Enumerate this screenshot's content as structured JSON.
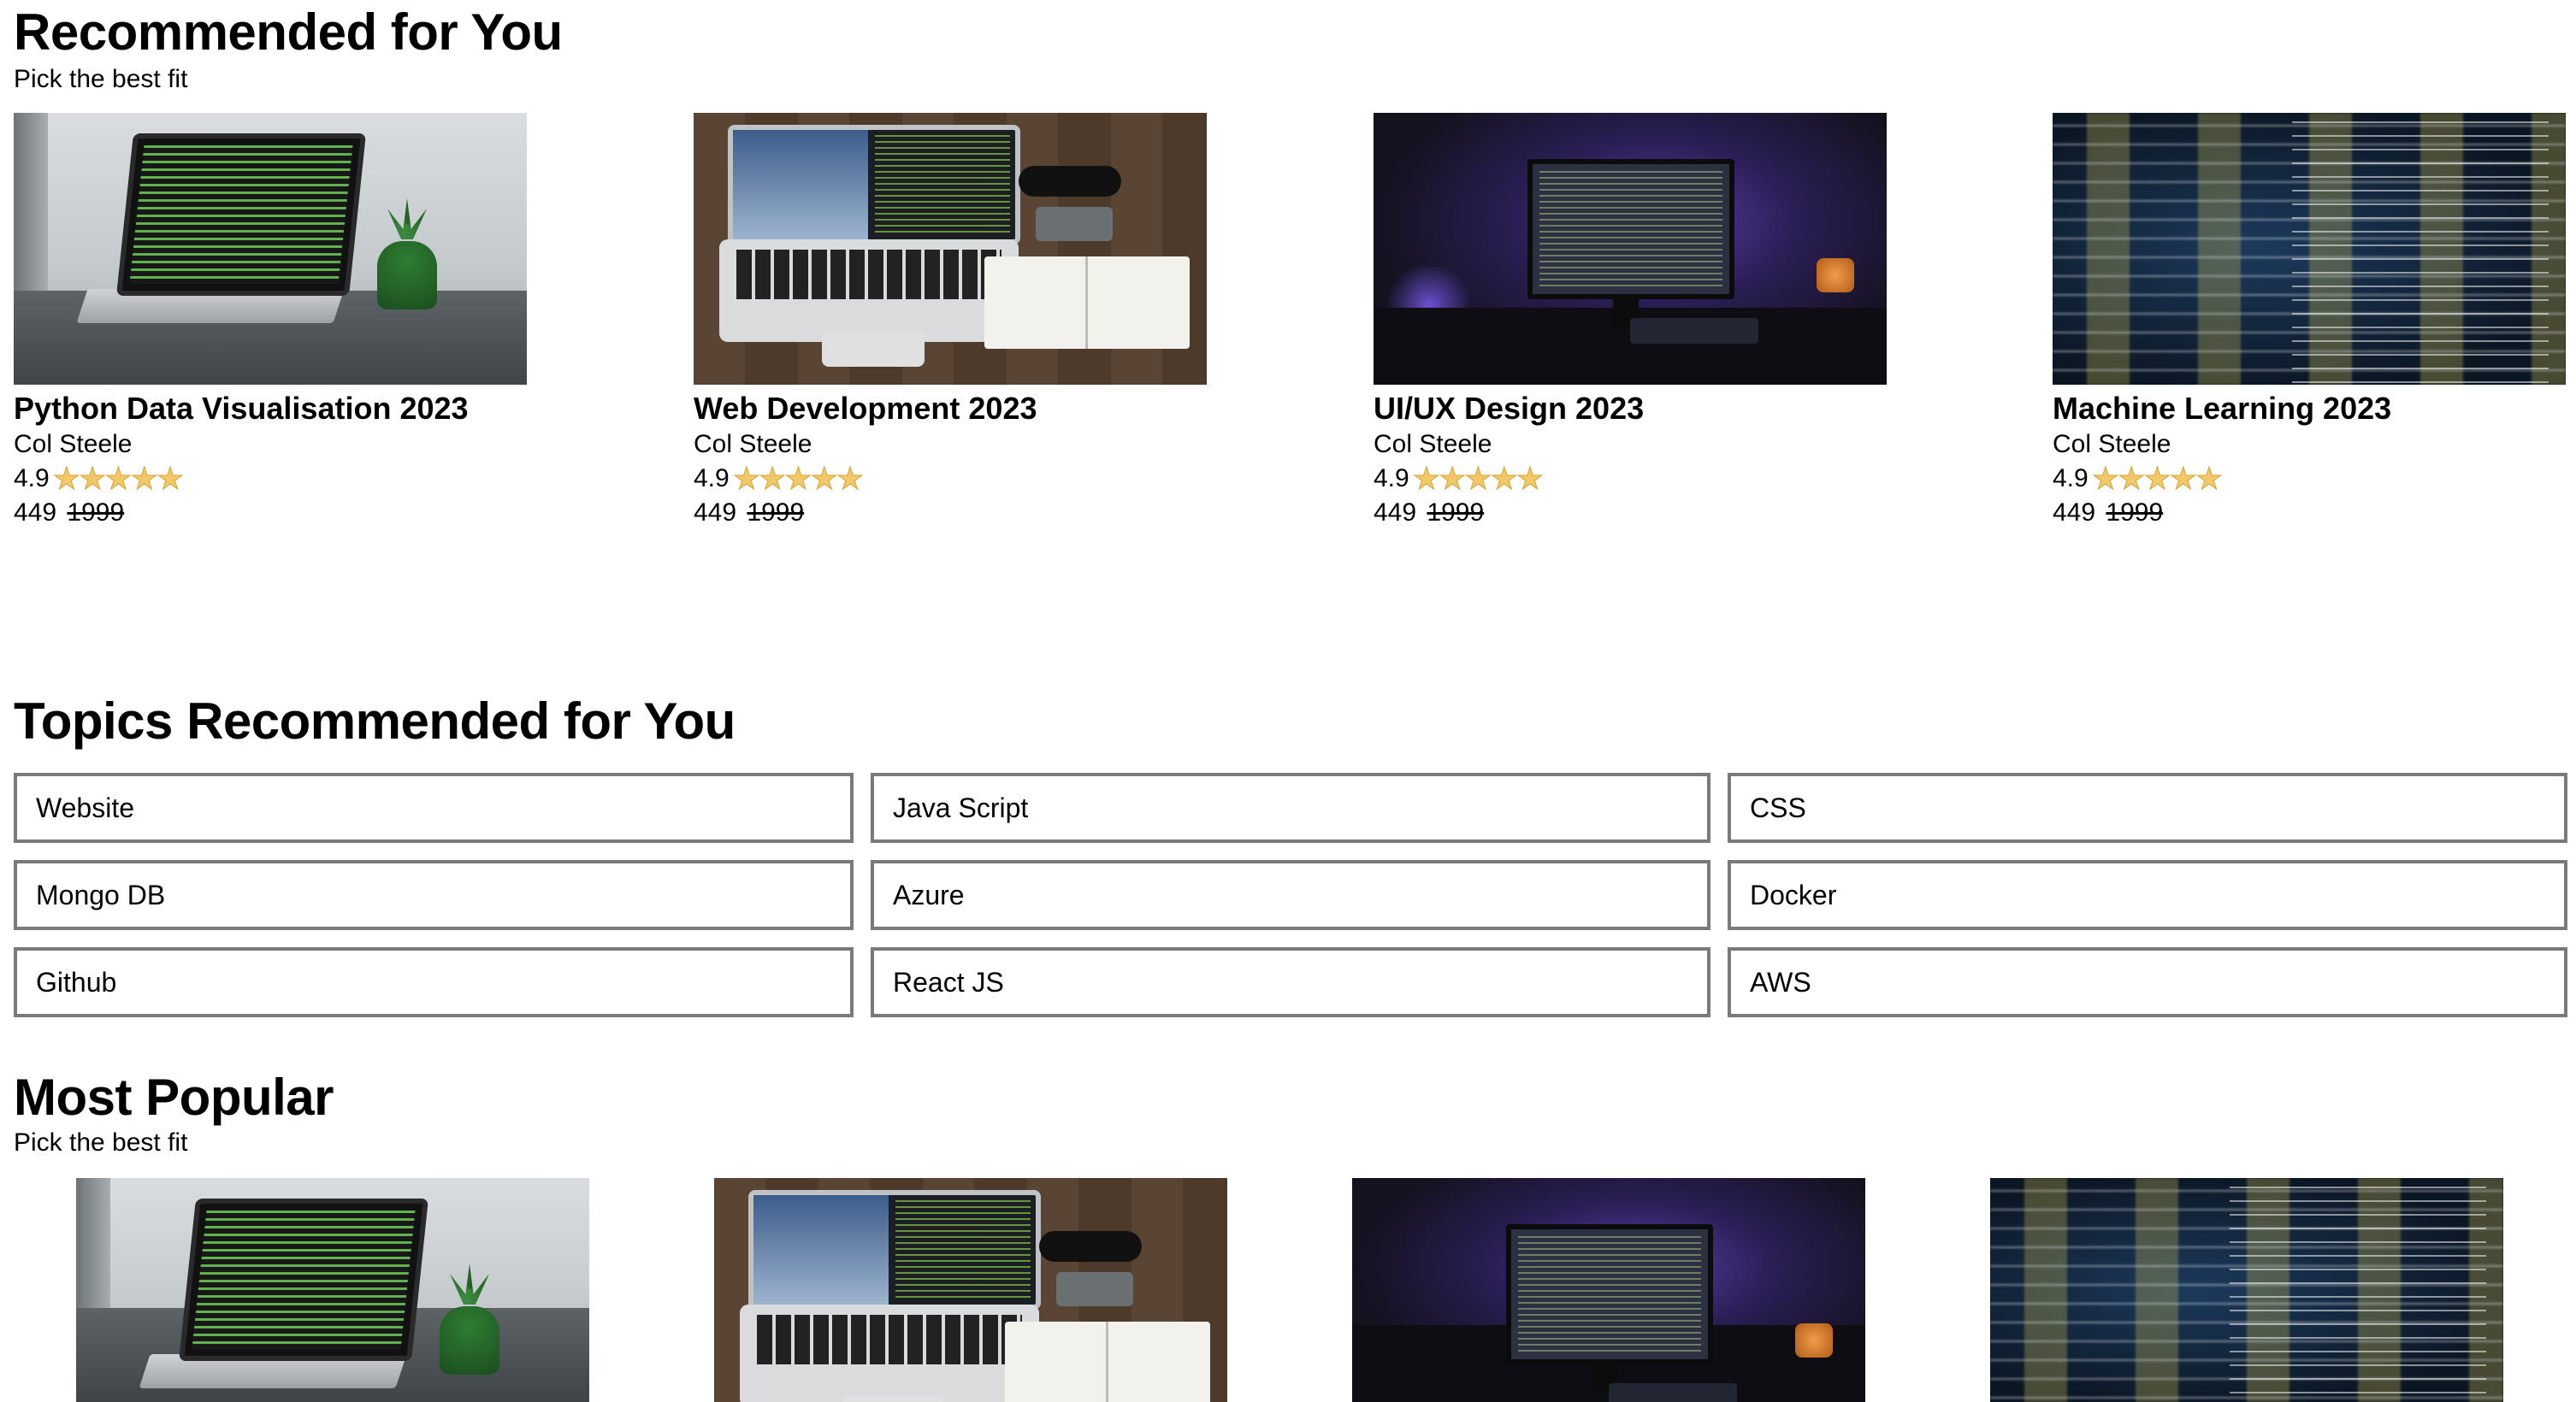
{
  "recommended": {
    "title": "Recommended for You",
    "subtitle": "Pick the best fit",
    "courses": [
      {
        "title": "Python Data Visualisation 2023",
        "author": "Col Steele",
        "rating": "4.9",
        "stars": 5,
        "price": "449",
        "old_price": "1999",
        "thumbnail": "laptop-with-plant-photo"
      },
      {
        "title": "Web Development 2023",
        "author": "Col Steele",
        "rating": "4.9",
        "stars": 5,
        "price": "449",
        "old_price": "1999",
        "thumbnail": "laptop-on-wooden-desk-photo"
      },
      {
        "title": "UI/UX Design 2023",
        "author": "Col Steele",
        "rating": "4.9",
        "stars": 5,
        "price": "449",
        "old_price": "1999",
        "thumbnail": "monitor-purple-light-photo"
      },
      {
        "title": "Machine Learning 2023",
        "author": "Col Steele",
        "rating": "4.9",
        "stars": 5,
        "price": "449",
        "old_price": "1999",
        "thumbnail": "blurred-code-photo"
      }
    ]
  },
  "topics": {
    "title": "Topics Recommended for You",
    "items": [
      "Website",
      "Java Script",
      "CSS",
      "Mongo DB",
      "Azure",
      "Docker",
      "Github",
      "React JS",
      "AWS"
    ]
  },
  "popular": {
    "title": "Most Popular",
    "subtitle": "Pick the best fit",
    "thumbnails": [
      "laptop-with-plant-photo",
      "laptop-on-wooden-desk-photo",
      "monitor-purple-light-photo",
      "blurred-code-photo"
    ]
  },
  "colors": {
    "star_fill": "#f1c96a",
    "topic_border": "#7a7a7a"
  }
}
